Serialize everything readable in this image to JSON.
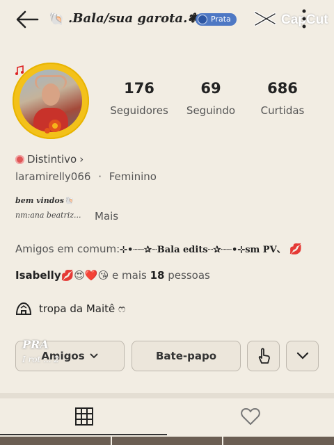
{
  "header": {
    "title": ".Bala/sua garota.❃",
    "title_emoji": "🐚",
    "badge": "Prata",
    "watermark": "CapCut"
  },
  "stats": [
    {
      "value": "176",
      "label": "Seguidores"
    },
    {
      "value": "69",
      "label": "Seguindo"
    },
    {
      "value": "686",
      "label": "Curtidas"
    }
  ],
  "profile": {
    "badge_label": "Distintivo",
    "badge_chevron": "›",
    "username": "laramirelly066",
    "separator": "·",
    "gender": "Feminino",
    "bio_line1": "bem vindos🐚",
    "bio_line2": "nm:ana beatriz...",
    "more": "Mais"
  },
  "friends_line": {
    "prefix": "Amigos em comum:",
    "name": "⊹•┈┈✰┈Bala edits┈✰┈┈•⊹sm PV、",
    "emoji": "💋"
  },
  "mutual": {
    "name": "Isabelly",
    "emojis": "💋😍❤️😘",
    "text": "e mais",
    "count": "18",
    "suffix": "pessoas"
  },
  "group": {
    "name": "tropa da Maitê ෆ"
  },
  "overlay": {
    "line1": "PRA",
    "line2": "I rot ... 2"
  },
  "buttons": {
    "friends": "Amigos",
    "chat": "Bate-papo"
  },
  "icons": {
    "back": "back-arrow-icon",
    "more": "more-vertical-icon",
    "share": "share-hand-icon",
    "dropdown": "chevron-down-icon",
    "grid": "grid-icon",
    "liked": "heart-icon",
    "group": "group-tent-icon"
  }
}
